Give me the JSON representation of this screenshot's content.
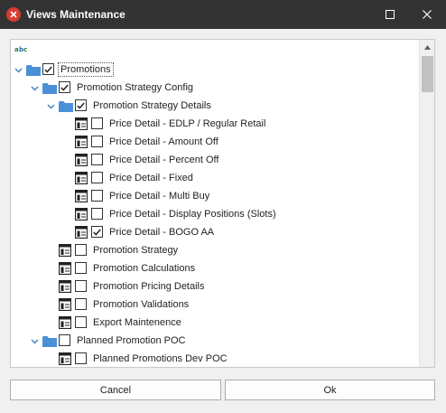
{
  "window": {
    "title": "Views Maintenance",
    "app_icon": "red-x-circle-icon"
  },
  "toolbar": {
    "abc_icon": "abc-sort-icon"
  },
  "tree": [
    {
      "label": "Promotions",
      "level": 0,
      "type": "folder",
      "expanded": true,
      "checked": true
    },
    {
      "label": "Promotion Strategy Config",
      "level": 1,
      "type": "folder",
      "expanded": true,
      "checked": true
    },
    {
      "label": "Promotion Strategy Details",
      "level": 2,
      "type": "folder",
      "expanded": true,
      "checked": true
    },
    {
      "label": "Price Detail - EDLP / Regular Retail",
      "level": 3,
      "type": "view",
      "checked": false
    },
    {
      "label": "Price Detail - Amount Off",
      "level": 3,
      "type": "view",
      "checked": false
    },
    {
      "label": "Price Detail - Percent Off",
      "level": 3,
      "type": "view",
      "checked": false
    },
    {
      "label": "Price Detail - Fixed",
      "level": 3,
      "type": "view",
      "checked": false
    },
    {
      "label": "Price Detail - Multi Buy",
      "level": 3,
      "type": "view",
      "checked": false
    },
    {
      "label": "Price Detail - Display Positions (Slots)",
      "level": 3,
      "type": "view",
      "checked": false
    },
    {
      "label": "Price Detail - BOGO AA",
      "level": 3,
      "type": "view",
      "checked": true
    },
    {
      "label": "Promotion Strategy",
      "level": 2,
      "type": "view",
      "checked": false
    },
    {
      "label": "Promotion Calculations",
      "level": 2,
      "type": "view",
      "checked": false
    },
    {
      "label": "Promotion Pricing Details",
      "level": 2,
      "type": "view",
      "checked": false
    },
    {
      "label": "Promotion Validations",
      "level": 2,
      "type": "view",
      "checked": false
    },
    {
      "label": "Export Maintenence",
      "level": 2,
      "type": "view",
      "checked": false
    },
    {
      "label": "Planned Promotion POC",
      "level": 1,
      "type": "folder",
      "expanded": true,
      "checked": false
    },
    {
      "label": "Planned Promotions Dev POC",
      "level": 2,
      "type": "view",
      "checked": false
    }
  ],
  "buttons": {
    "cancel": "Cancel",
    "ok": "Ok"
  },
  "colors": {
    "titlebar": "#333333",
    "folder": "#4a90d9",
    "expander": "#3c7fc2",
    "app_icon": "#d83b31"
  }
}
